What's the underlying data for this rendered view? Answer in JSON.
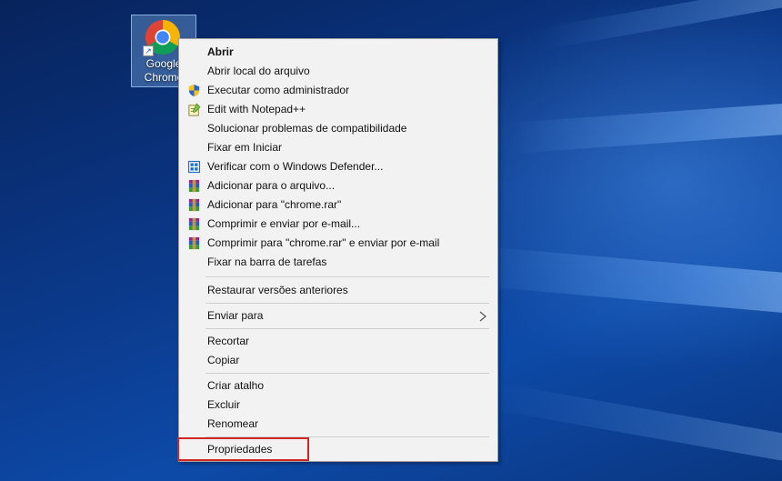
{
  "desktop": {
    "icon": {
      "name": "chrome-shortcut",
      "label": "Google\nChrome"
    }
  },
  "context_menu": {
    "items": [
      {
        "label": "Abrir",
        "bold": true,
        "icon": ""
      },
      {
        "label": "Abrir local do arquivo",
        "icon": ""
      },
      {
        "label": "Executar como administrador",
        "icon": "uac-shield-icon"
      },
      {
        "label": "Edit with Notepad++",
        "icon": "notepad-plus-plus-icon"
      },
      {
        "label": "Solucionar problemas de compatibilidade",
        "icon": ""
      },
      {
        "label": "Fixar em Iniciar",
        "icon": ""
      },
      {
        "label": "Verificar com o Windows Defender...",
        "icon": "windows-defender-icon"
      },
      {
        "label": "Adicionar para o arquivo...",
        "icon": "winrar-icon"
      },
      {
        "label": "Adicionar para \"chrome.rar\"",
        "icon": "winrar-icon"
      },
      {
        "label": "Comprimir e enviar por e-mail...",
        "icon": "winrar-icon"
      },
      {
        "label": "Comprimir para \"chrome.rar\" e enviar por e-mail",
        "icon": "winrar-icon"
      },
      {
        "label": "Fixar na barra de tarefas",
        "icon": ""
      },
      {
        "label": "Restaurar versões anteriores",
        "icon": ""
      },
      {
        "label": "Enviar para",
        "icon": "",
        "submenu": true
      },
      {
        "label": "Recortar",
        "icon": ""
      },
      {
        "label": "Copiar",
        "icon": ""
      },
      {
        "label": "Criar atalho",
        "icon": ""
      },
      {
        "label": "Excluir",
        "icon": ""
      },
      {
        "label": "Renomear",
        "icon": ""
      },
      {
        "label": "Propriedades",
        "icon": "",
        "highlighted": true
      }
    ]
  },
  "colors": {
    "menu_bg": "#f2f2f2",
    "highlight_border": "#d42525",
    "desktop_blue": "#0b3a8c"
  }
}
